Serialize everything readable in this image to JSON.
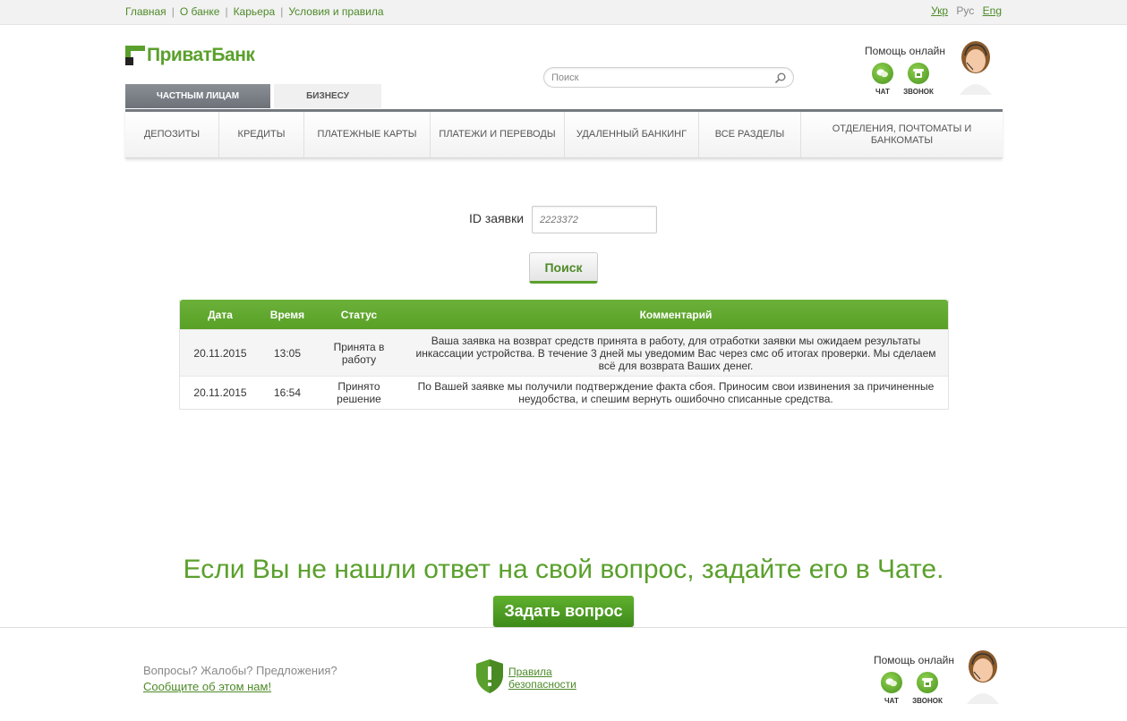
{
  "top_nav": {
    "links": [
      "Главная",
      "О банке",
      "Карьера",
      "Условия и правила"
    ],
    "languages": {
      "ukr": "Укр",
      "rus": "Рус",
      "eng": "Eng"
    }
  },
  "logo": {
    "text": "ПриватБанк"
  },
  "segments": {
    "private": "ЧАСТНЫМ ЛИЦАМ",
    "business": "БИЗНЕСУ"
  },
  "search": {
    "placeholder": "Поиск"
  },
  "help": {
    "title": "Помощь онлайн",
    "chat_label": "ЧАТ",
    "call_label": "ЗВОНОК"
  },
  "main_nav": [
    {
      "label": "ДЕПОЗИТЫ"
    },
    {
      "label": "КРЕДИТЫ"
    },
    {
      "label": "ПЛАТЕЖНЫЕ КАРТЫ"
    },
    {
      "label": "ПЛАТЕЖИ И ПЕРЕВОДЫ"
    },
    {
      "label": "УДАЛЕННЫЙ БАНКИНГ"
    },
    {
      "label": "ВСЕ РАЗДЕЛЫ"
    },
    {
      "label": "ОТДЕЛЕНИЯ, ПОЧТОМАТЫ И БАНКОМАТЫ"
    }
  ],
  "form": {
    "id_label": "ID заявки",
    "id_value": "2223372",
    "search_button": "Поиск"
  },
  "table": {
    "headers": [
      "Дата",
      "Время",
      "Статус",
      "Комментарий"
    ],
    "rows": [
      {
        "date": "20.11.2015",
        "time": "13:05",
        "status": "Принята в работу",
        "comment": "Ваша заявка на возврат средств принята в работу, для отработки заявки мы ожидаем результаты инкассации устройства. В течение 3 дней мы уведомим Вас через смс об итогах проверки. Мы сделаем всё для возврата Ваших денег."
      },
      {
        "date": "20.11.2015",
        "time": "16:54",
        "status": "Принято решение",
        "comment": "По Вашей заявке мы получили подтверждение факта сбоя. Приносим свои извинения за причиненные неудобства, и спешим вернуть ошибочно списанные средства."
      }
    ]
  },
  "promo": {
    "text": "Если Вы не нашли ответ на свой вопрос, задайте его в Чате.",
    "button": "Задать вопрос"
  },
  "footer": {
    "question": "Вопросы? Жалобы? Предложения?",
    "report_link": "Сообщите об этом нам!",
    "security_line1": "Правила",
    "security_line2": "безопасности"
  },
  "colors": {
    "brand_green": "#5aa02c",
    "nav_dark": "#747a80"
  }
}
